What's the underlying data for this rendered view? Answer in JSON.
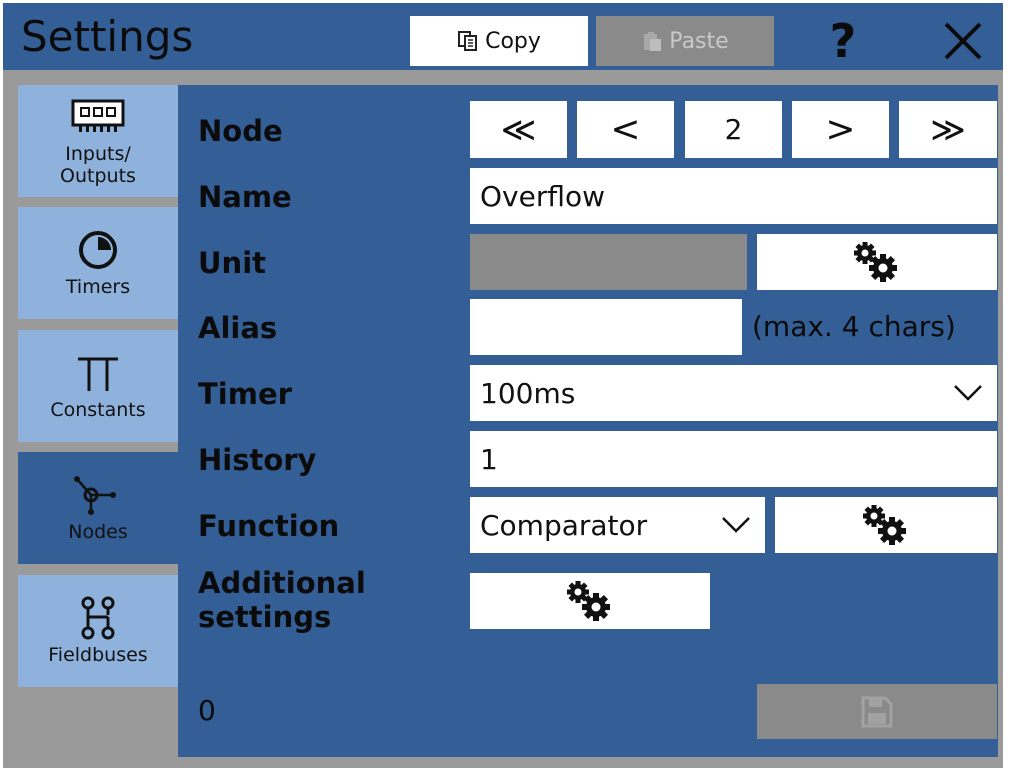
{
  "header": {
    "title": "Settings",
    "copy_label": "Copy",
    "paste_label": "Paste",
    "help_label": "?"
  },
  "sidebar": {
    "items": [
      {
        "label_line1": "Inputs/",
        "label_line2": "Outputs",
        "icon": "io-chip-icon",
        "active": false
      },
      {
        "label_line1": "Timers",
        "icon": "timer-clock-icon",
        "active": false
      },
      {
        "label_line1": "Constants",
        "icon": "pi-constant-icon",
        "active": false
      },
      {
        "label_line1": "Nodes",
        "icon": "node-graph-icon",
        "active": true
      },
      {
        "label_line1": "Fieldbuses",
        "icon": "network-tree-icon",
        "active": false
      }
    ]
  },
  "form": {
    "node_label": "Node",
    "node_first": "≪",
    "node_prev": "<",
    "node_value": "2",
    "node_next": ">",
    "node_last": "≫",
    "name_label": "Name",
    "name_value": "Overflow",
    "unit_label": "Unit",
    "alias_label": "Alias",
    "alias_value": "",
    "alias_hint": "(max. 4 chars)",
    "timer_label": "Timer",
    "timer_value": "100ms",
    "history_label": "History",
    "history_value": "1",
    "function_label": "Function",
    "function_value": "Comparator",
    "additional_label_line1": "Additional",
    "additional_label_line2": "settings"
  },
  "footer": {
    "counter": "0"
  },
  "colors": {
    "panel": "#345e96",
    "tab": "#8fb2dd",
    "disabled": "#8a8a8a",
    "frame": "#9a9a9a"
  }
}
